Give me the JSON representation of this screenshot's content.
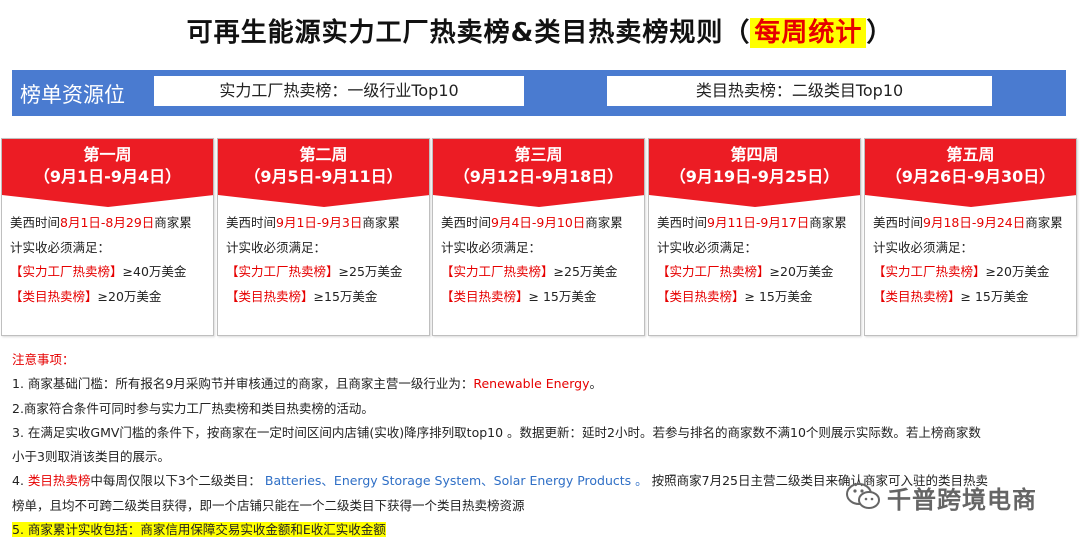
{
  "title": {
    "main": "可再生能源实力工厂热卖榜&类目热卖榜规则（",
    "highlight": "每周统计",
    "close": "）"
  },
  "resource_bar": {
    "label": "榜单资源位",
    "box1": "实力工厂热卖榜：一级行业Top10",
    "box2": "类目热卖榜：二级类目Top10"
  },
  "weeks": [
    {
      "name": "第一周",
      "dates": "（9月1日-9月4日）",
      "period": "8月1日-8月29日",
      "factory_value": "≥40万美金",
      "category_value": "≥20万美金"
    },
    {
      "name": "第二周",
      "dates": "（9月5日-9月11日）",
      "period": "9月1日-9月3日",
      "factory_value": "≥25万美金",
      "category_value": "≥15万美金"
    },
    {
      "name": "第三周",
      "dates": "（9月12日-9月18日）",
      "period": "9月4日-9月10日",
      "factory_value": "≥25万美金",
      "category_value": "≥ 15万美金"
    },
    {
      "name": "第四周",
      "dates": "（9月19日-9月25日）",
      "period": "9月11日-9月17日",
      "factory_value": "≥20万美金",
      "category_value": "≥ 15万美金"
    },
    {
      "name": "第五周",
      "dates": "（9月26日-9月30日）",
      "period": "9月18日-9月24日",
      "factory_value": "≥20万美金",
      "category_value": "≥ 15万美金"
    }
  ],
  "week_common": {
    "prefix": "美西时间",
    "suffix": "商家累",
    "line2": "计实收必须满足：",
    "factory_label": "【实力工厂热卖榜】",
    "category_label": "【类目热卖榜】"
  },
  "notes": {
    "heading": "注意事项：",
    "n1_text": "1. 商家基础门槛：所有报名9月采购节并审核通过的商家，且商家主营一级行业为：",
    "n1_red": "Renewable Energy",
    "n1_end": "。",
    "n2": "2.商家符合条件可同时参与实力工厂热卖榜和类目热卖榜的活动。",
    "n3a": "3. 在满足实收GMV门槛的条件下，按商家在一定时间区间内店铺(实收)降序排列取top10 。数据更新：延时2小时。若参与排名的商家数不满10个则展示实际数。若上榜商家数",
    "n3b": "小于3则取消该类目的展示。",
    "n4_num": "4. ",
    "n4_red": "类目热卖榜",
    "n4_text": "中每周仅限以下3个二级类目：",
    "n4_blue": "Batteries、Energy Storage System、Solar Energy Products 。",
    "n4_rest": "按照商家7月25日主营二级类目来确认商家可入驻的类目热卖",
    "n4b": "榜单，且均不可跨二级类目获得，即一个店铺只能在一个二级类目下获得一个类目热卖榜资源",
    "n5": "5. 商家累计实收包括：商家信用保障交易实收金额和E收汇实收金额"
  },
  "watermark": {
    "text": "千普跨境电商",
    "icon": "wechat-icon"
  },
  "colors": {
    "red": "#ec1c24",
    "blue_bar": "#4a7bd0",
    "highlight": "#ffff00",
    "note_blue": "#2f6fc6"
  }
}
